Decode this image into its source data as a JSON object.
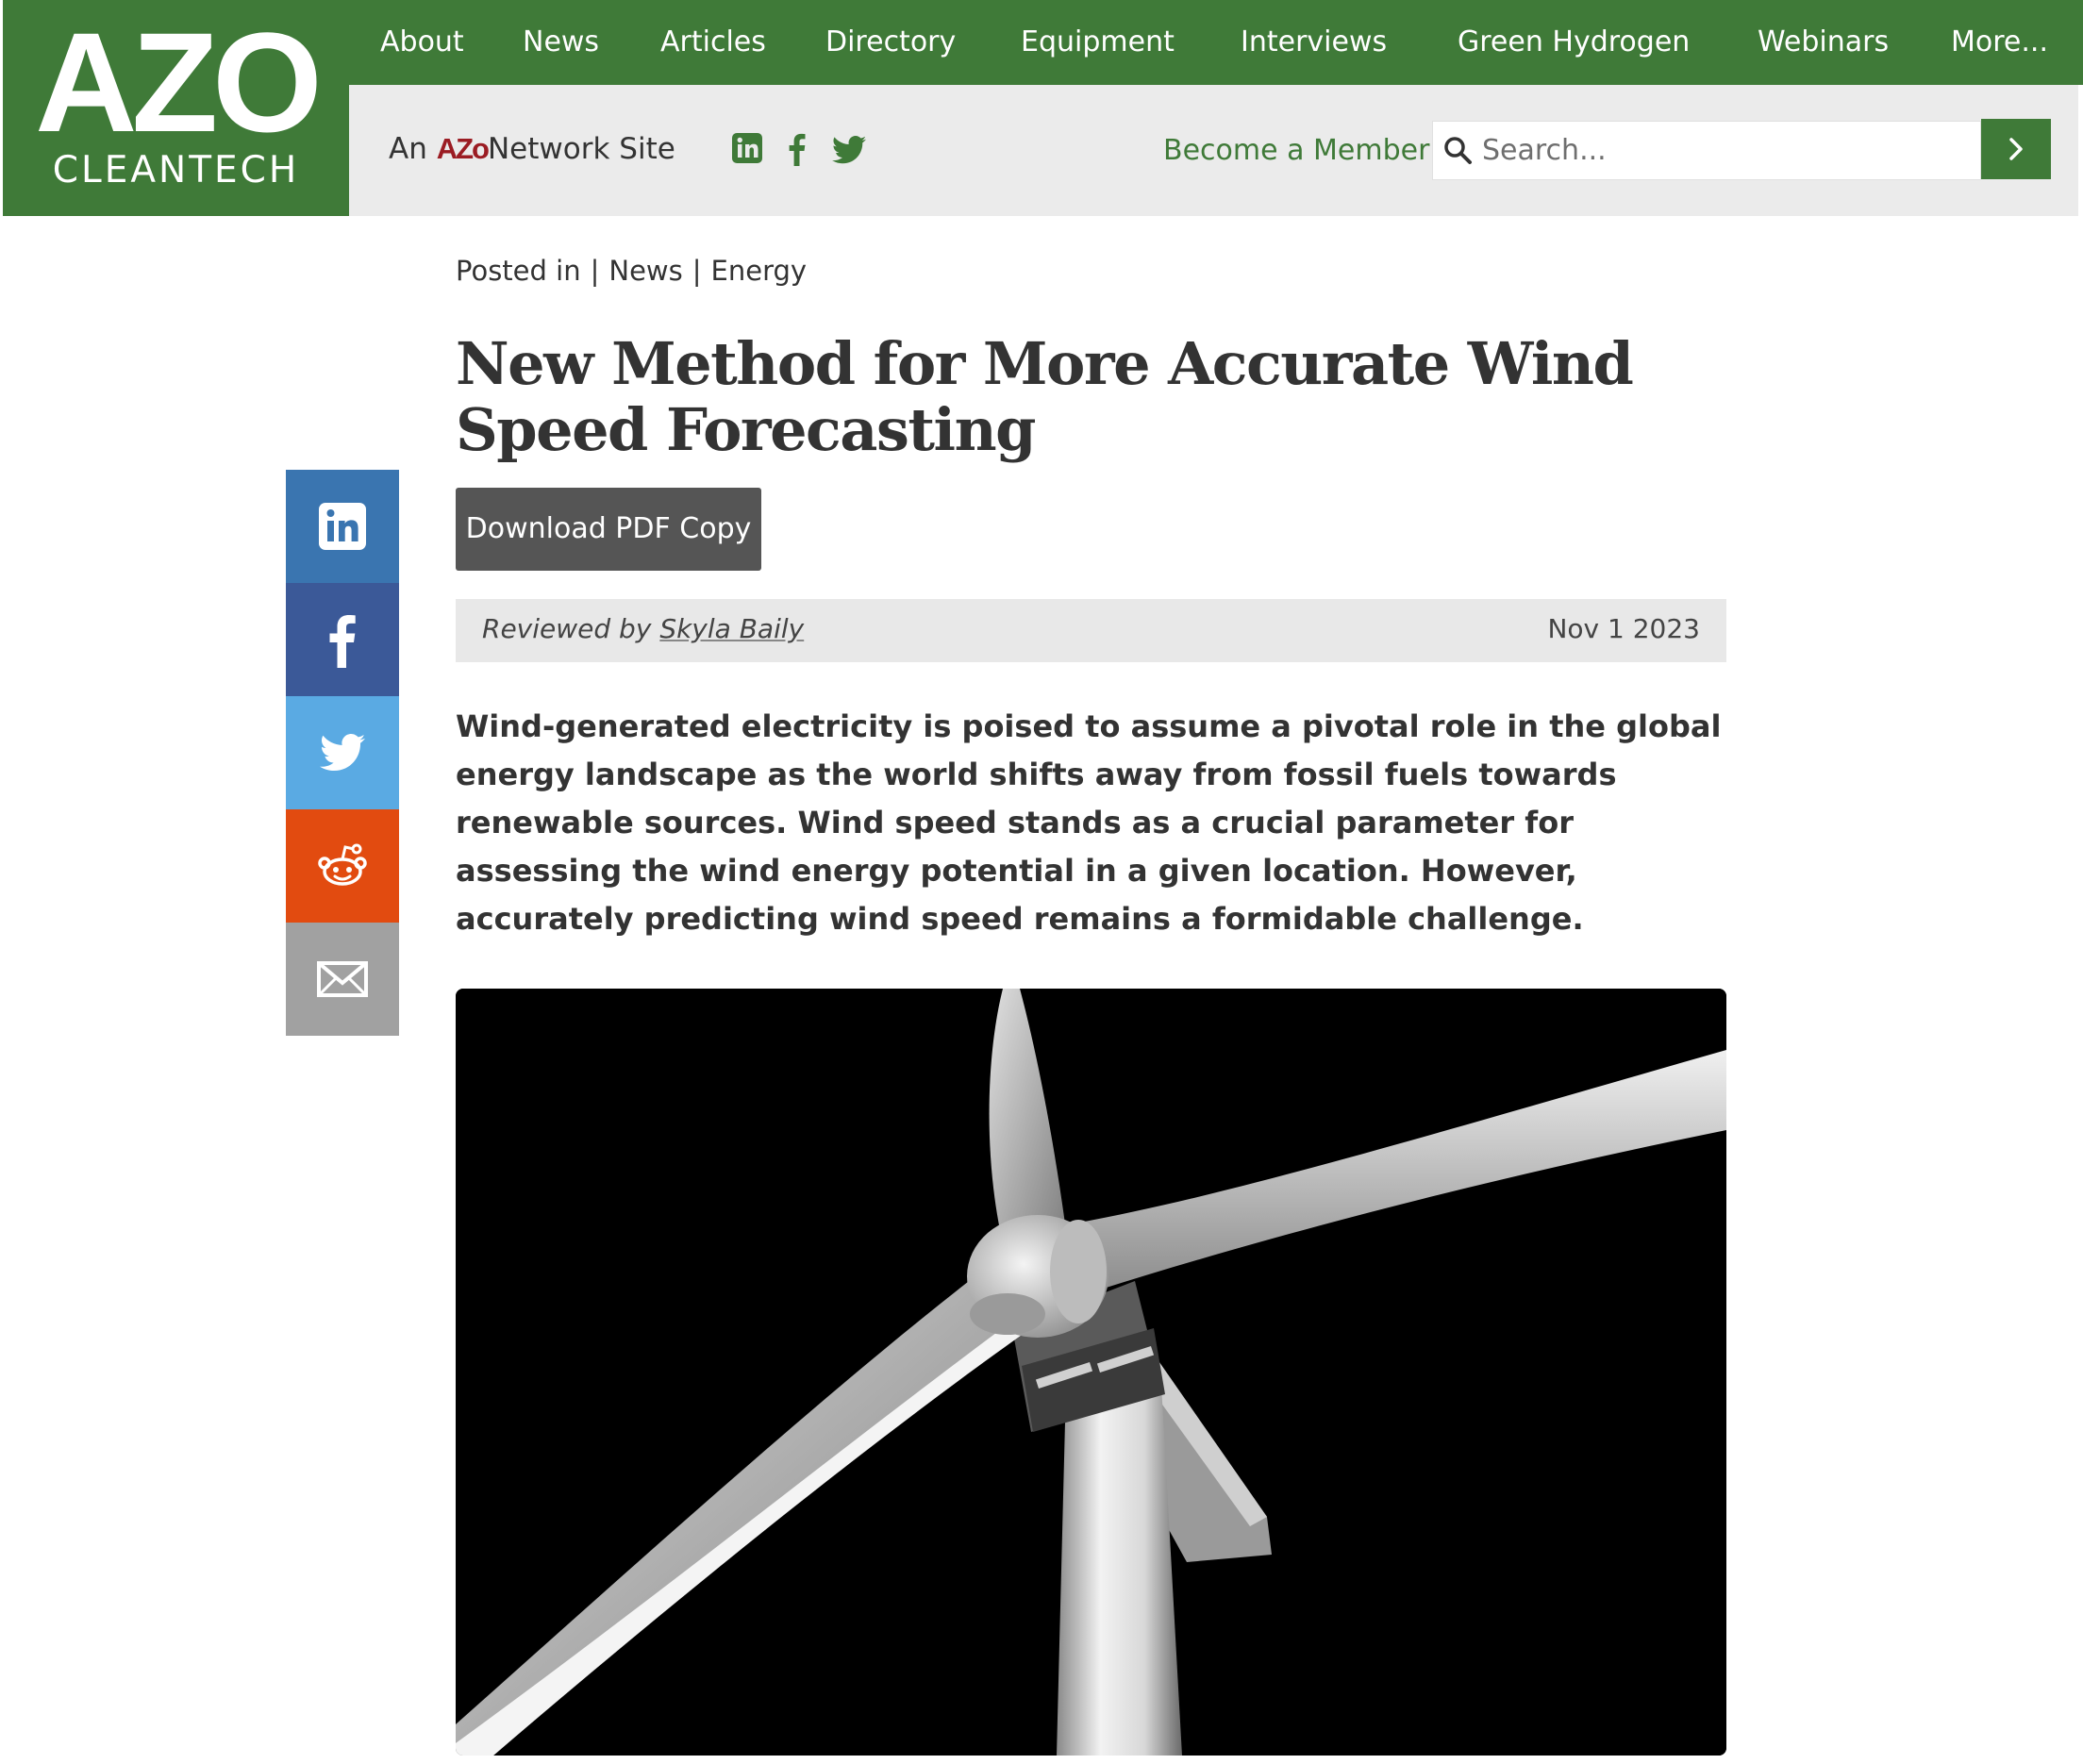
{
  "logo": {
    "main": "AZO",
    "sub": "CLEANTECH"
  },
  "nav": {
    "items": [
      "About",
      "News",
      "Articles",
      "Directory",
      "Equipment",
      "Interviews",
      "Green Hydrogen",
      "Webinars",
      "More..."
    ]
  },
  "subheader": {
    "network_prefix": "An",
    "network_brand": "AZo",
    "network_rest": "Network",
    "network_suffix": "Site",
    "social_icons": [
      "linkedin-icon",
      "facebook-icon",
      "twitter-icon"
    ],
    "become_member": "Become a Member",
    "search_placeholder": "Search..."
  },
  "share": [
    {
      "name": "linkedin",
      "color": "#3a75b0"
    },
    {
      "name": "facebook",
      "color": "#3b5998"
    },
    {
      "name": "twitter",
      "color": "#5aaae3"
    },
    {
      "name": "reddit",
      "color": "#e24b10"
    },
    {
      "name": "email",
      "color": "#a1a1a1"
    }
  ],
  "article": {
    "posted_in": "Posted in",
    "categories": [
      "News",
      "Energy"
    ],
    "title": "New Method for More Accurate Wind Speed Forecasting",
    "download_pdf": "Download PDF Copy",
    "reviewed_by_label": "Reviewed by",
    "reviewer": "Skyla Baily",
    "date": "Nov 1 2023",
    "lead": "Wind-generated electricity is poised to assume a pivotal role in the global energy landscape as the world shifts away from fossil fuels towards renewable sources. Wind speed stands as a crucial parameter for assessing the wind energy potential in a given location. However, accurately predicting wind speed remains a formidable challenge."
  },
  "colors": {
    "brand_green": "#3f7a38",
    "subheader_bg": "#ebebeb",
    "pdf_button": "#555555"
  }
}
